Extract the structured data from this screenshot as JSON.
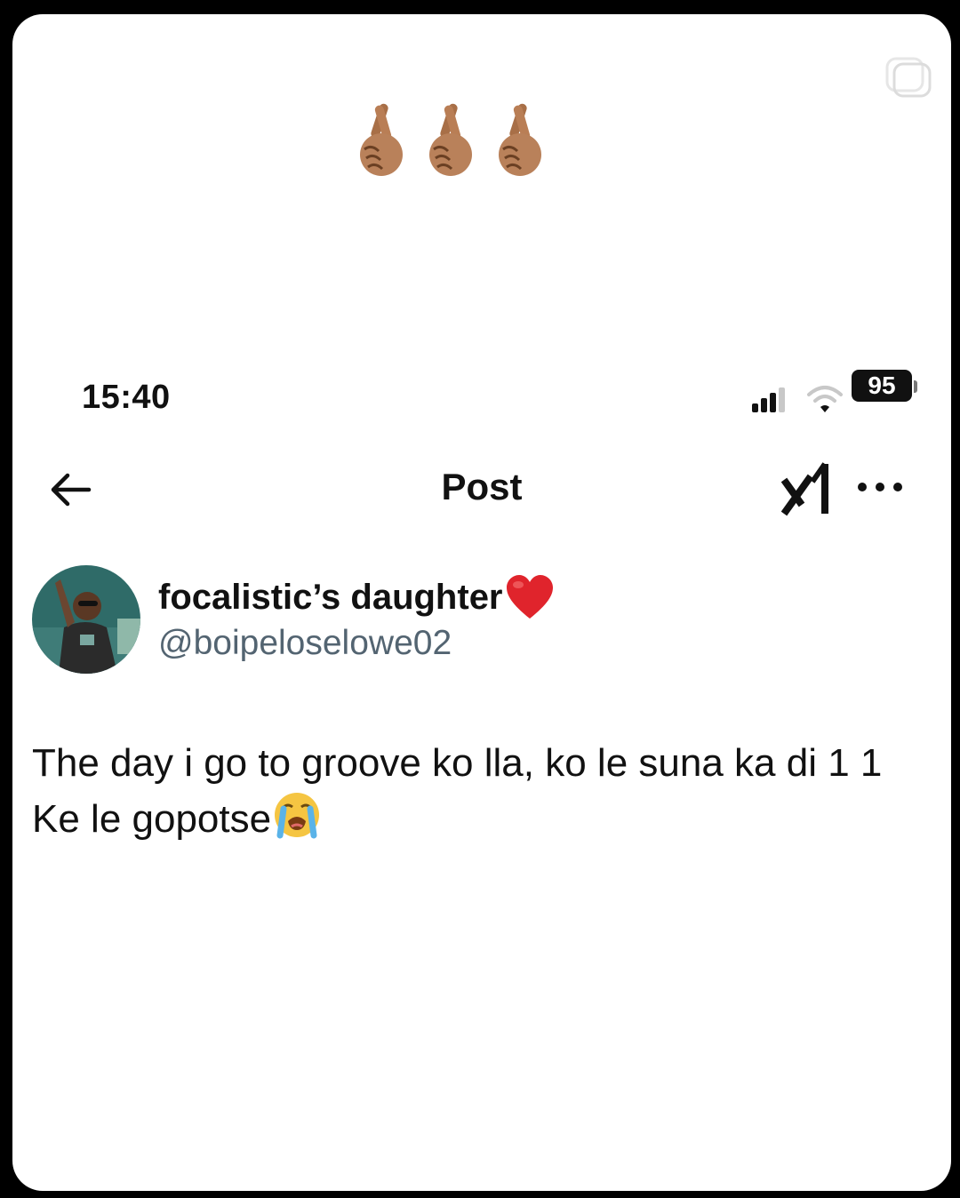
{
  "story": {
    "emojis": [
      "crossed-fingers-icon",
      "crossed-fingers-icon",
      "crossed-fingers-icon"
    ],
    "copy_icon": "copy-icon"
  },
  "status_bar": {
    "time": "15:40",
    "battery": "95"
  },
  "nav": {
    "back_icon": "back-arrow-icon",
    "title": "Post",
    "grok_icon": "grok-icon",
    "more_icon": "more-icon"
  },
  "post": {
    "author": {
      "display_name": "focalistic’s daughter",
      "name_emoji": "red-heart-icon",
      "handle": "@boipeloselowe02"
    },
    "text_line1": "The day i go to groove ko lla, ko le suna ka di 1 1",
    "text_line2": "Ke le gopotse",
    "text_emoji": "loudly-crying-face-icon"
  },
  "colors": {
    "background": "#ffffff",
    "text": "#111111",
    "handle": "#536471",
    "heart": "#e0242c",
    "skin": "#b07a54"
  }
}
